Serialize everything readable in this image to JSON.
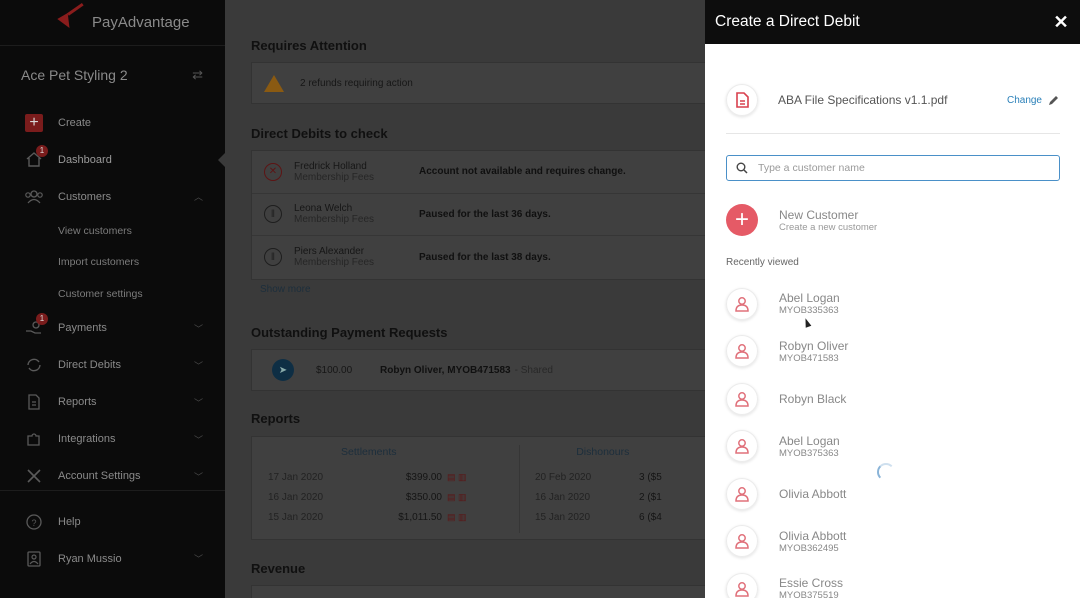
{
  "sidebar": {
    "brand": "PayAdvantage",
    "org_name": "Ace Pet Styling 2",
    "nav": [
      {
        "label": "Create",
        "icon": "plus-icon"
      },
      {
        "label": "Dashboard",
        "icon": "home-icon",
        "badge": "1",
        "active": true
      },
      {
        "label": "Customers",
        "icon": "users-icon",
        "expanded": true
      }
    ],
    "customers_sub": [
      "View customers",
      "Import customers",
      "Customer settings"
    ],
    "nav2": [
      {
        "label": "Payments",
        "icon": "hand-coin-icon",
        "badge": "1"
      },
      {
        "label": "Direct Debits",
        "icon": "repeat-icon"
      },
      {
        "label": "Reports",
        "icon": "document-icon"
      },
      {
        "label": "Integrations",
        "icon": "puzzle-icon"
      },
      {
        "label": "Account Settings",
        "icon": "tools-icon"
      }
    ],
    "bottom": [
      {
        "label": "Help",
        "icon": "help-icon"
      },
      {
        "label": "Ryan Mussio",
        "icon": "user-badge-icon"
      }
    ]
  },
  "main": {
    "requires_attention": {
      "title": "Requires Attention",
      "text": "2 refunds requiring action"
    },
    "direct_debits": {
      "title": "Direct Debits to check",
      "rows": [
        {
          "name": "Fredrick Holland",
          "plan": "Membership Fees",
          "message": "Account not available and requires change.",
          "status": "error"
        },
        {
          "name": "Leona Welch",
          "plan": "Membership Fees",
          "message": "Paused for the last 36 days.",
          "status": "paused"
        },
        {
          "name": "Piers Alexander",
          "plan": "Membership Fees",
          "message": "Paused for the last 38 days.",
          "status": "paused"
        }
      ],
      "show_more": "Show more"
    },
    "payment_requests": {
      "title": "Outstanding Payment Requests",
      "amount": "$100.00",
      "customer": "Robyn Oliver, MYOB471583",
      "tag": "- Shared"
    },
    "reports": {
      "title": "Reports",
      "settlements_label": "Settlements",
      "dishonours_label": "Dishonours",
      "settlements": [
        {
          "date": "17 Jan 2020",
          "amount": "$399.00"
        },
        {
          "date": "16 Jan 2020",
          "amount": "$350.00"
        },
        {
          "date": "15 Jan 2020",
          "amount": "$1,011.50"
        }
      ],
      "dishonours": [
        {
          "date": "20 Feb 2020",
          "count": "3 ($5"
        },
        {
          "date": "16 Jan 2020",
          "count": "2 ($1"
        },
        {
          "date": "15 Jan 2020",
          "count": "6 ($4"
        }
      ]
    },
    "revenue": {
      "title": "Revenue"
    }
  },
  "panel": {
    "title": "Create a Direct Debit",
    "file_name": "ABA File Specifications v1.1.pdf",
    "change_label": "Change",
    "search_placeholder": "Type a customer name",
    "new_customer": {
      "title": "New Customer",
      "subtitle": "Create a new customer"
    },
    "recent_label": "Recently viewed",
    "customers": [
      {
        "name": "Abel Logan",
        "id": "MYOB335363"
      },
      {
        "name": "Robyn Oliver",
        "id": "MYOB471583"
      },
      {
        "name": "Robyn Black",
        "id": ""
      },
      {
        "name": "Abel Logan",
        "id": "MYOB375363"
      },
      {
        "name": "Olivia Abbott",
        "id": ""
      },
      {
        "name": "Olivia Abbott",
        "id": "MYOB362495"
      },
      {
        "name": "Essie Cross",
        "id": "MYOB375519"
      }
    ]
  },
  "colors": {
    "accent_red": "#e55a66",
    "link_blue": "#2a80b9",
    "focus_blue": "#4a90c8",
    "overlay": "#3a3a3a"
  }
}
